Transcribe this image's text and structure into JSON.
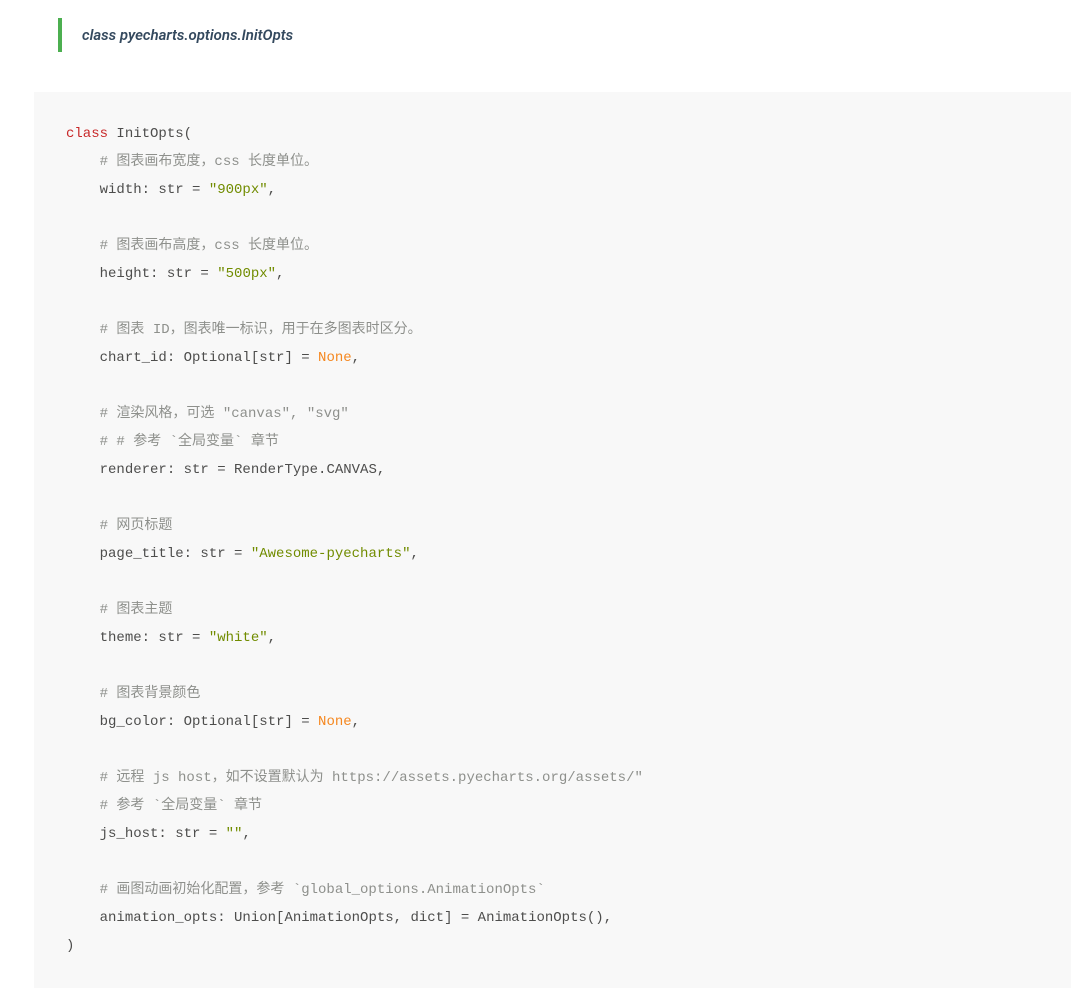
{
  "header": {
    "class_title": "class pyecharts.options.InitOpts"
  },
  "code": {
    "keyword_class": "class",
    "class_name": " InitOpts(",
    "l_pad": "    ",
    "c_width": "# 图表画布宽度，css 长度单位。",
    "f_width_a": "width: str = ",
    "f_width_s": "\"900px\"",
    "f_width_z": ",",
    "c_height": "# 图表画布高度，css 长度单位。",
    "f_height_a": "height: str = ",
    "f_height_s": "\"500px\"",
    "f_height_z": ",",
    "c_chartid": "# 图表 ID，图表唯一标识，用于在多图表时区分。",
    "f_chartid_a": "chart_id: Optional[str] = ",
    "f_chartid_n": "None",
    "f_chartid_z": ",",
    "c_renderer1": "# 渲染风格，可选 \"canvas\", \"svg\"",
    "c_renderer2": "# # 参考 `全局变量` 章节",
    "f_renderer": "renderer: str = RenderType.CANVAS,",
    "c_pagetitle": "# 网页标题",
    "f_pagetitle_a": "page_title: str = ",
    "f_pagetitle_s": "\"Awesome-pyecharts\"",
    "f_pagetitle_z": ",",
    "c_theme": "# 图表主题",
    "f_theme_a": "theme: str = ",
    "f_theme_s": "\"white\"",
    "f_theme_z": ",",
    "c_bgcolor": "# 图表背景颜色",
    "f_bgcolor_a": "bg_color: Optional[str] = ",
    "f_bgcolor_n": "None",
    "f_bgcolor_z": ",",
    "c_jshost1": "# 远程 js host，如不设置默认为 https://assets.pyecharts.org/assets/\"",
    "c_jshost2": "# 参考 `全局变量` 章节",
    "f_jshost_a": "js_host: str = ",
    "f_jshost_s": "\"\"",
    "f_jshost_z": ",",
    "c_anim": "# 画图动画初始化配置，参考 `global_options.AnimationOpts`",
    "f_anim": "animation_opts: Union[AnimationOpts, dict] = AnimationOpts(),",
    "close": ")"
  }
}
